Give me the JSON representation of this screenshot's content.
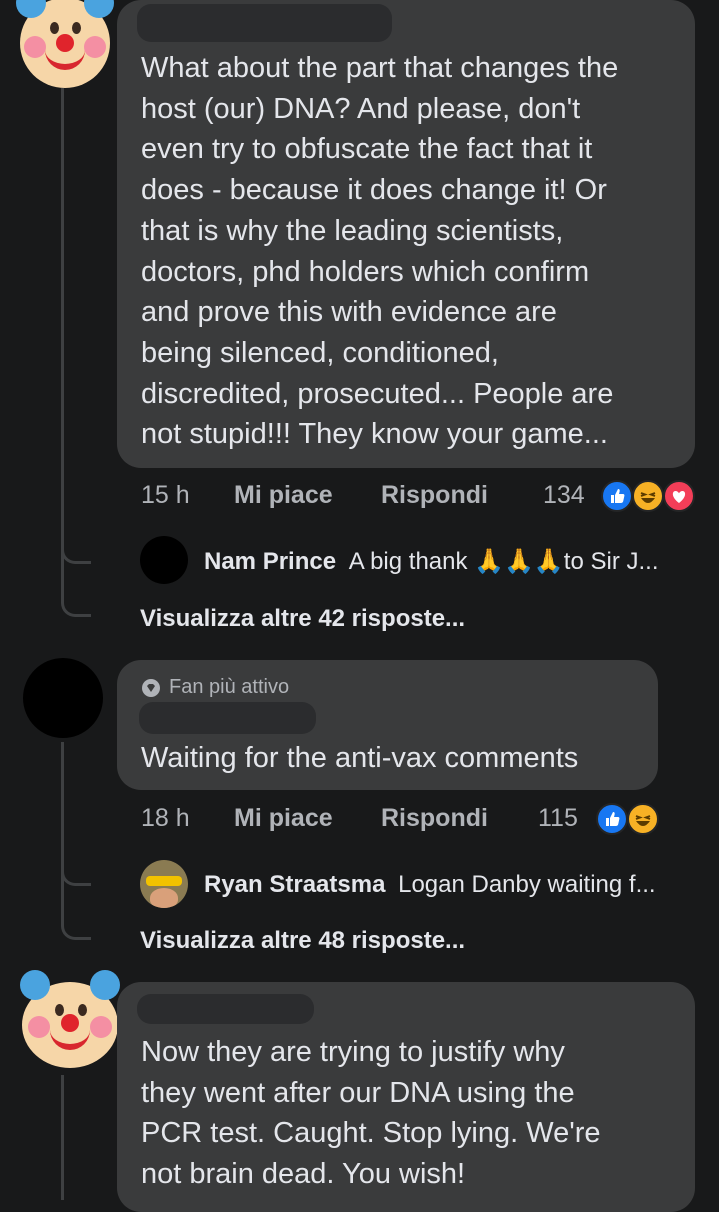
{
  "comments": [
    {
      "text": "What about the part that changes the\nhost (our) DNA? And please, don't\neven try to obfuscate the fact that it\ndoes - because it does change it! Or\nthat is why the leading scientists,\ndoctors, phd holders which confirm\nand prove this with evidence are\nbeing silenced, conditioned,\ndiscredited, prosecuted... People are\nnot stupid!!! They know your game...",
      "time": "15 h",
      "like_label": "Mi piace",
      "reply_label": "Rispondi",
      "reaction_count": "134",
      "reactions": [
        "like-icon",
        "haha-icon",
        "love-icon"
      ],
      "reply_preview": {
        "name": "Nam Prince",
        "text": "A big thank 🙏🙏🙏to Sir J..."
      },
      "more_replies": "Visualizza altre 42 risposte..."
    },
    {
      "badge": "Fan più attivo",
      "text": "Waiting for the anti-vax comments",
      "time": "18 h",
      "like_label": "Mi piace",
      "reply_label": "Rispondi",
      "reaction_count": "115",
      "reactions": [
        "like-icon",
        "haha-icon"
      ],
      "reply_preview": {
        "name": "Ryan Straatsma",
        "text": "Logan Danby waiting f..."
      },
      "more_replies": "Visualizza altre 48 risposte..."
    },
    {
      "text": "Now they are trying to justify why\nthey went after our DNA using the\nPCR test. Caught. Stop lying. We're\nnot brain dead. You wish!"
    }
  ],
  "colors": {
    "background": "#18191a",
    "bubble": "#3a3b3c",
    "like": "#1877f2",
    "haha": "#f7b125",
    "love": "#f33e58"
  }
}
